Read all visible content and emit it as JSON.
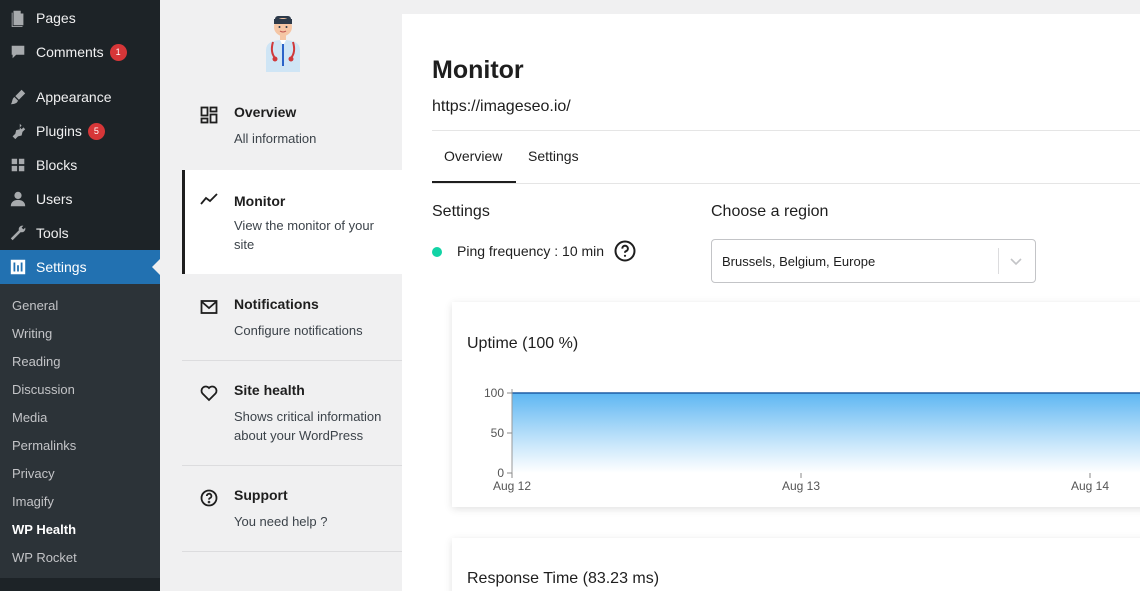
{
  "wp_menu": {
    "pages": "Pages",
    "comments": "Comments",
    "comments_badge": "1",
    "appearance": "Appearance",
    "plugins": "Plugins",
    "plugins_badge": "5",
    "blocks": "Blocks",
    "users": "Users",
    "tools": "Tools",
    "settings": "Settings"
  },
  "wp_submenu": [
    "General",
    "Writing",
    "Reading",
    "Discussion",
    "Media",
    "Permalinks",
    "Privacy",
    "Imagify",
    "WP Health",
    "WP Rocket"
  ],
  "plugin_nav": {
    "overview": {
      "title": "Overview",
      "desc": "All information"
    },
    "monitor": {
      "title": "Monitor",
      "desc": "View the monitor of your site"
    },
    "notifications": {
      "title": "Notifications",
      "desc": "Configure notifications"
    },
    "site_health": {
      "title": "Site health",
      "desc": "Shows critical information about your WordPress"
    },
    "support": {
      "title": "Support",
      "desc": "You need help ?"
    }
  },
  "main": {
    "title": "Monitor",
    "url": "https://imageseo.io/",
    "tabs": [
      {
        "label": "Overview"
      },
      {
        "label": "Settings"
      }
    ],
    "settings_heading": "Settings",
    "ping_text": "Ping frequency : 10 min",
    "region_heading": "Choose a region",
    "region_value": "Brussels, Belgium, Europe"
  },
  "colors": {
    "status_dot": "#12d3a5",
    "chart_line": "#1f5fa6",
    "chart_fill_top": "#5db6f2"
  },
  "chart_data": [
    {
      "type": "area",
      "title": "Uptime (100 %)",
      "x": [
        "Aug 12",
        "Aug 13",
        "Aug 14"
      ],
      "series": [
        {
          "values": [
            100,
            100,
            100
          ]
        }
      ],
      "yticks": [
        0,
        50,
        100
      ],
      "ylim": [
        0,
        100
      ],
      "grid": false
    },
    {
      "type": "area",
      "title": "Response Time (83.23 ms)"
    }
  ]
}
